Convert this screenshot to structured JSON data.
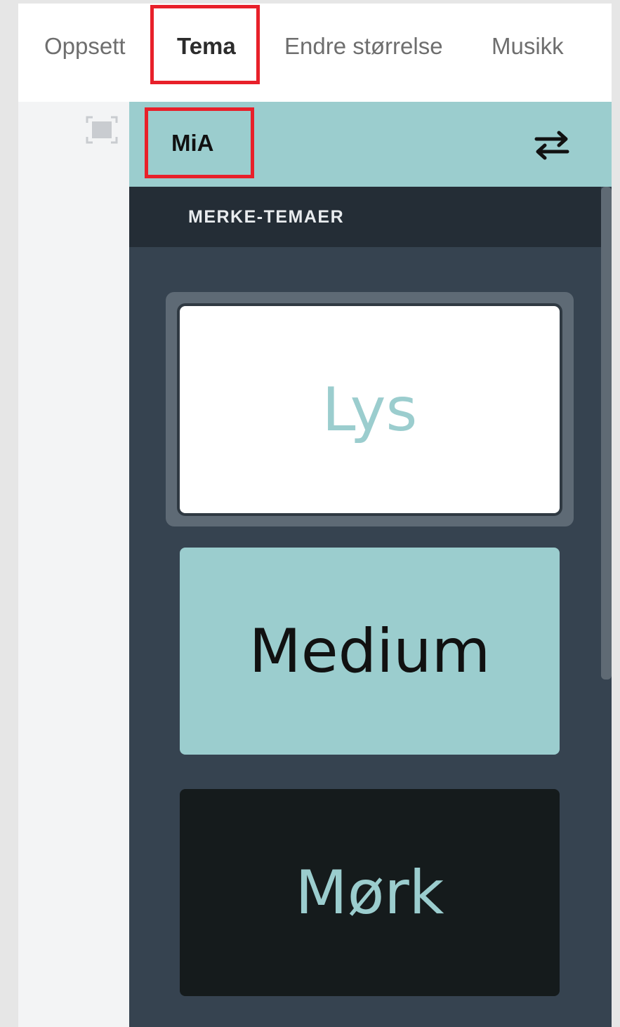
{
  "tabs": [
    {
      "label": "Oppsett"
    },
    {
      "label": "Tema"
    },
    {
      "label": "Endre størrelse"
    },
    {
      "label": "Musikk"
    }
  ],
  "active_tab": "Tema",
  "brand": {
    "name": "MiA"
  },
  "section": {
    "title": "MERKE-TEMAER"
  },
  "themes": [
    {
      "label": "Lys"
    },
    {
      "label": "Medium"
    },
    {
      "label": "Mørk"
    }
  ],
  "selected_theme": "Lys",
  "icons": {
    "fit": "fit-to-screen-icon",
    "swap": "swap-arrows-icon"
  },
  "colors": {
    "accent": "#9bcdce",
    "panel_bg": "#364350",
    "section_header_bg": "#242d36",
    "dark_card": "#151b1c",
    "highlight": "#e8202a"
  }
}
